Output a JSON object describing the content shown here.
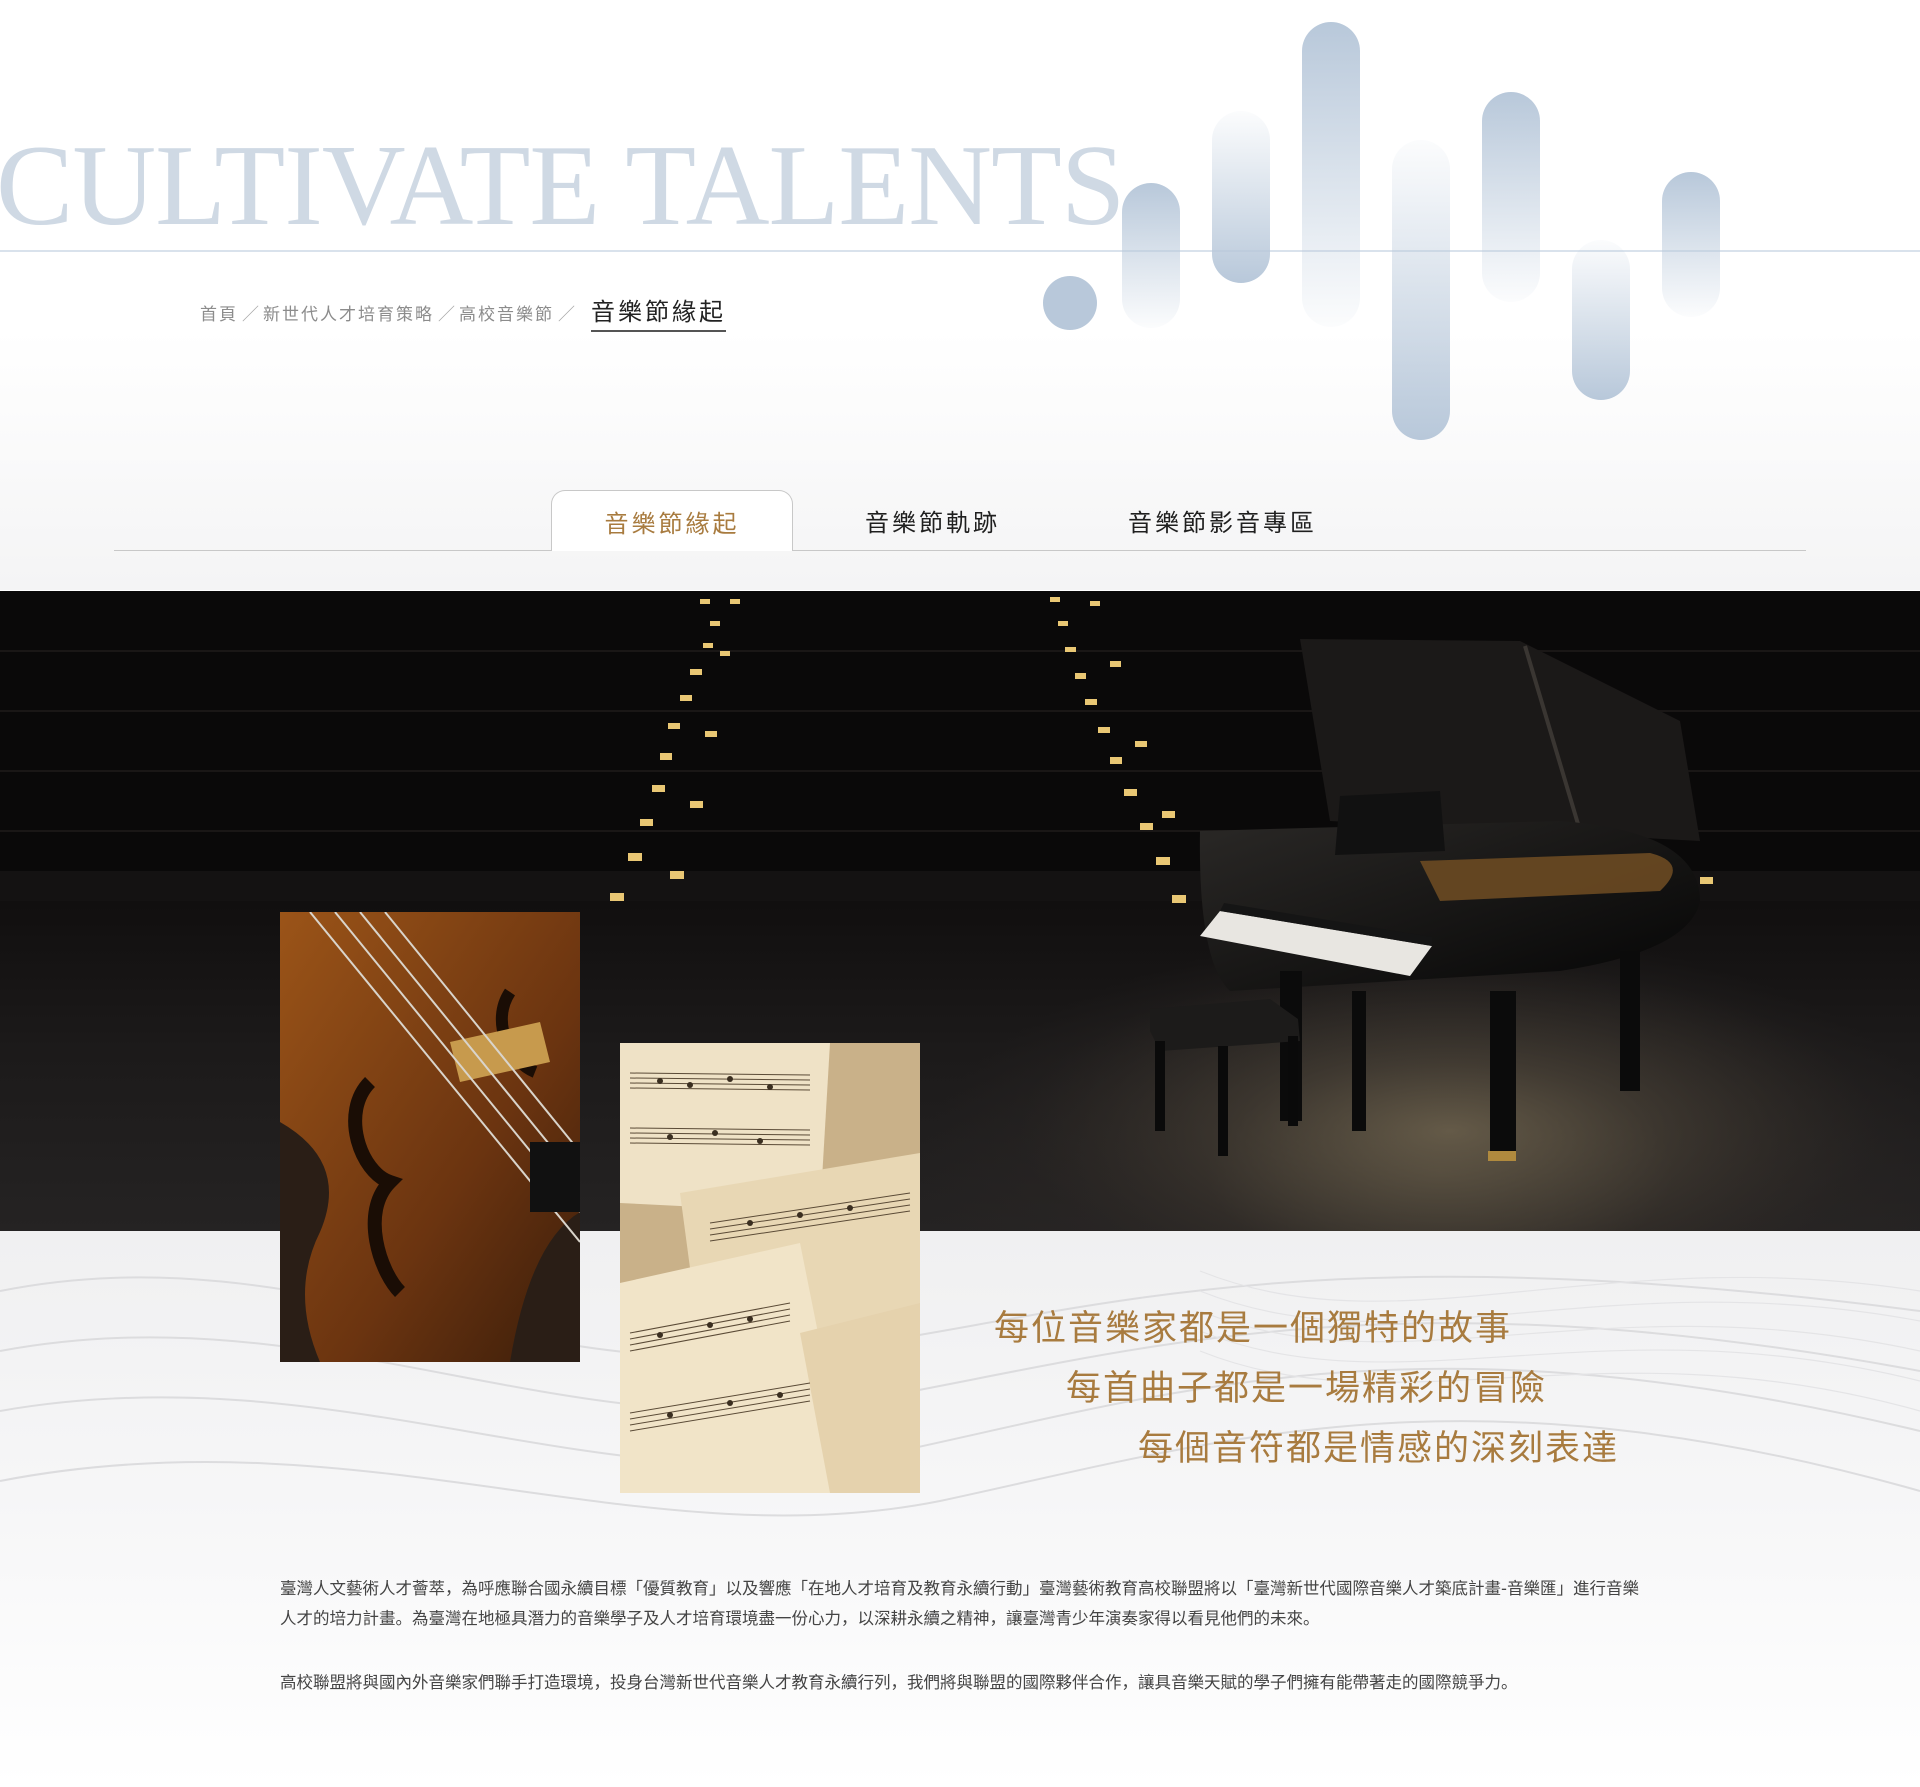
{
  "hero": {
    "title": "CULTIVATE TALENTS"
  },
  "breadcrumb": {
    "items": [
      "首頁",
      "新世代人才培育策略",
      "高校音樂節"
    ],
    "separator": "／",
    "current": "音樂節緣起"
  },
  "tabs": [
    {
      "label": "音樂節緣起",
      "active": true
    },
    {
      "label": "音樂節軌跡",
      "active": false
    },
    {
      "label": "音樂節影音專區",
      "active": false
    }
  ],
  "slogans": [
    "每位音樂家都是一個獨特的故事",
    "每首曲子都是一場精彩的冒險",
    "每個音符都是情感的深刻表達"
  ],
  "intro": {
    "paragraph_1": "臺灣人文藝術人才薈萃，為呼應聯合國永續目標「優質教育」以及響應「在地人才培育及教育永續行動」臺灣藝術教育高校聯盟將以「臺灣新世代國際音樂人才築底計畫-音樂匯」進行音樂人才的培力計畫。為臺灣在地極具潛力的音樂學子及人才培育環境盡一份心力，以深耕永續之精神，讓臺灣青少年演奏家得以看見他們的未來。",
    "paragraph_2": "高校聯盟將與國內外音樂家們聯手打造環境，投身台灣新世代音樂人才教育永續行列，我們將與聯盟的國際夥伴合作，讓具音樂天賦的學子們擁有能帶著走的國際競爭力。"
  },
  "images": {
    "hero_banner": "concert-hall-grand-piano",
    "photo_1": "violin-closeup",
    "photo_2": "sheet-music"
  },
  "colors": {
    "accent_gold": "#a87b3f",
    "title_blue_gray": "#cfd9e4",
    "wave_bar": "#b8c8da"
  }
}
